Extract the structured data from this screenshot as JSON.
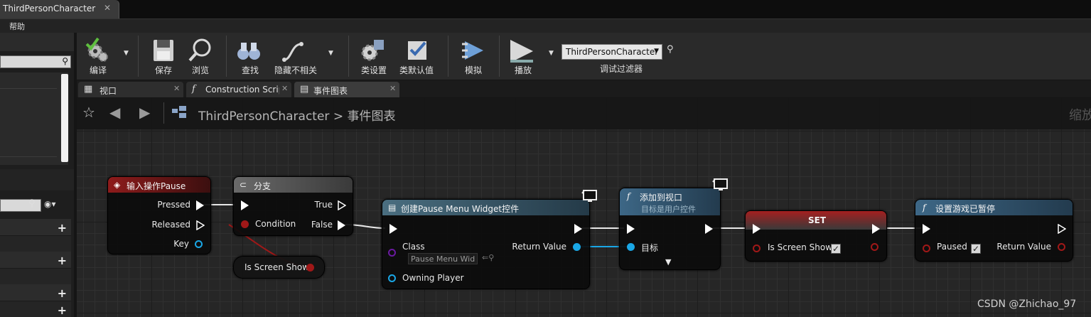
{
  "window": {
    "doc_tab": "ThirdPersonCharacter",
    "close_glyph": "✕"
  },
  "menu": {
    "help": "帮助"
  },
  "toolbar": {
    "compile": "编译",
    "save": "保存",
    "browse": "浏览",
    "find": "查找",
    "hide_unrelated": "隐藏不相关",
    "class_settings": "类设置",
    "class_defaults": "类默认值",
    "simulate": "模拟",
    "play": "播放",
    "debug_object": "ThirdPersonCharacter",
    "debug_filter_label": "调试过滤器"
  },
  "editor_tabs": [
    {
      "label": "视口",
      "icon": "grid-icon"
    },
    {
      "label": "Construction Scrip",
      "icon": "function-icon"
    },
    {
      "label": "事件图表",
      "icon": "graph-icon"
    }
  ],
  "breadcrumb": {
    "root": "ThirdPersonCharacter",
    "separator": ">",
    "current": "事件图表",
    "zoom_label": "缩放"
  },
  "nodes": {
    "input_action": {
      "title": "输入操作Pause",
      "pins": {
        "pressed": "Pressed",
        "released": "Released",
        "key": "Key"
      }
    },
    "branch": {
      "title": "分支",
      "pins": {
        "condition": "Condition",
        "true": "True",
        "false": "False"
      }
    },
    "get_var": {
      "label": "Is Screen Show"
    },
    "create_widget": {
      "title": "创建Pause Menu Widget控件",
      "pins": {
        "class": "Class",
        "class_value": "Pause Menu Wid",
        "owning_player": "Owning Player",
        "return_value": "Return Value"
      }
    },
    "add_to_viewport": {
      "title": "添加到视口",
      "subtitle": "目标是用户控件",
      "pins": {
        "target": "目标"
      }
    },
    "set_var": {
      "title": "SET",
      "pins": {
        "var": "Is Screen Show"
      }
    },
    "set_paused": {
      "title": "设置游戏已暂停",
      "pins": {
        "paused": "Paused",
        "return_value": "Return Value"
      }
    }
  },
  "watermark": "CSDN @Zhichao_97",
  "colors": {
    "exec": "#ffffff",
    "bool": "#a01818",
    "object": "#1aa7e6",
    "class": "#6a1aa0"
  }
}
